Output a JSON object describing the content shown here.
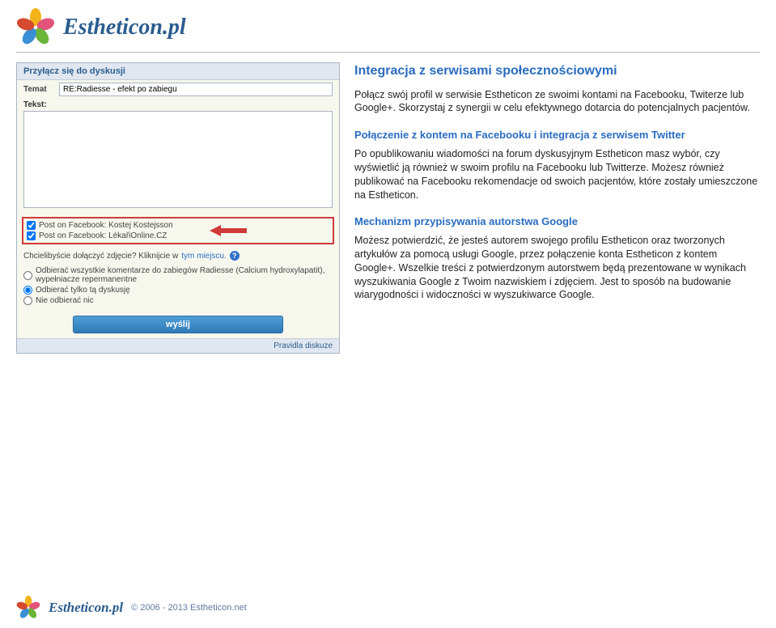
{
  "brand": "Estheticon.pl",
  "form": {
    "title": "Przyłącz się do dyskusji",
    "subject_label": "Temat",
    "subject_value": "RE:Radiesse - efekt po zabiegu",
    "text_label": "Tekst:",
    "post_fb1": "Post on Facebook: Kostej Kostejsson",
    "post_fb2": "Post on Facebook: LékařiOnline.CZ",
    "attach_text": "Chcielibyście dołączyć zdjęcie? Kliknijcie w",
    "attach_link": "tym miejscu.",
    "radio1": "Odbierać wszystkie komentarze do zabiegów Radiesse (Calcium hydroxylapatit), wypełniacze repermanentne",
    "radio2": "Odbierać tylko tą dyskusję",
    "radio3": "Nie odbierać nic",
    "send": "wyślij",
    "rules": "Pravidla diskuze"
  },
  "content": {
    "h2": "Integracja z serwisami społecznościowymi",
    "p1": "Połącz swój profil w serwisie Estheticon ze swoimi kontami na Facebooku, Twiterze lub Google+. Skorzystaj z synergii w celu efektywnego dotarcia do potencjalnych pacjentów.",
    "h3a": "Połączenie z kontem na Facebooku i integracja z serwisem Twitter",
    "p2": "Po opublikowaniu wiadomości na forum dyskusyjnym Estheticon masz wybór, czy wyświetlić ją również w swoim profilu na Facebooku lub Twitterze. Możesz również publikować na Facebooku rekomendacje od swoich pacjentów, które zostały umieszczone na Estheticon.",
    "h3b": "Mechanizm przypisywania autorstwa Google",
    "p3": "Możesz potwierdzić, że jesteś autorem swojego profilu Estheticon oraz tworzonych artykułów za pomocą usługi Google, przez połączenie konta Estheticon z kontem Google+. Wszelkie treści z potwierdzonym autorstwem będą prezentowane w wynikach wyszukiwania Google z Twoim nazwiskiem i zdjęciem. Jest to sposób na budowanie wiarygodności i widoczności w wyszukiwarce Google."
  },
  "footer": {
    "copyright": "© 2006 - 2013 Estheticon.net"
  }
}
